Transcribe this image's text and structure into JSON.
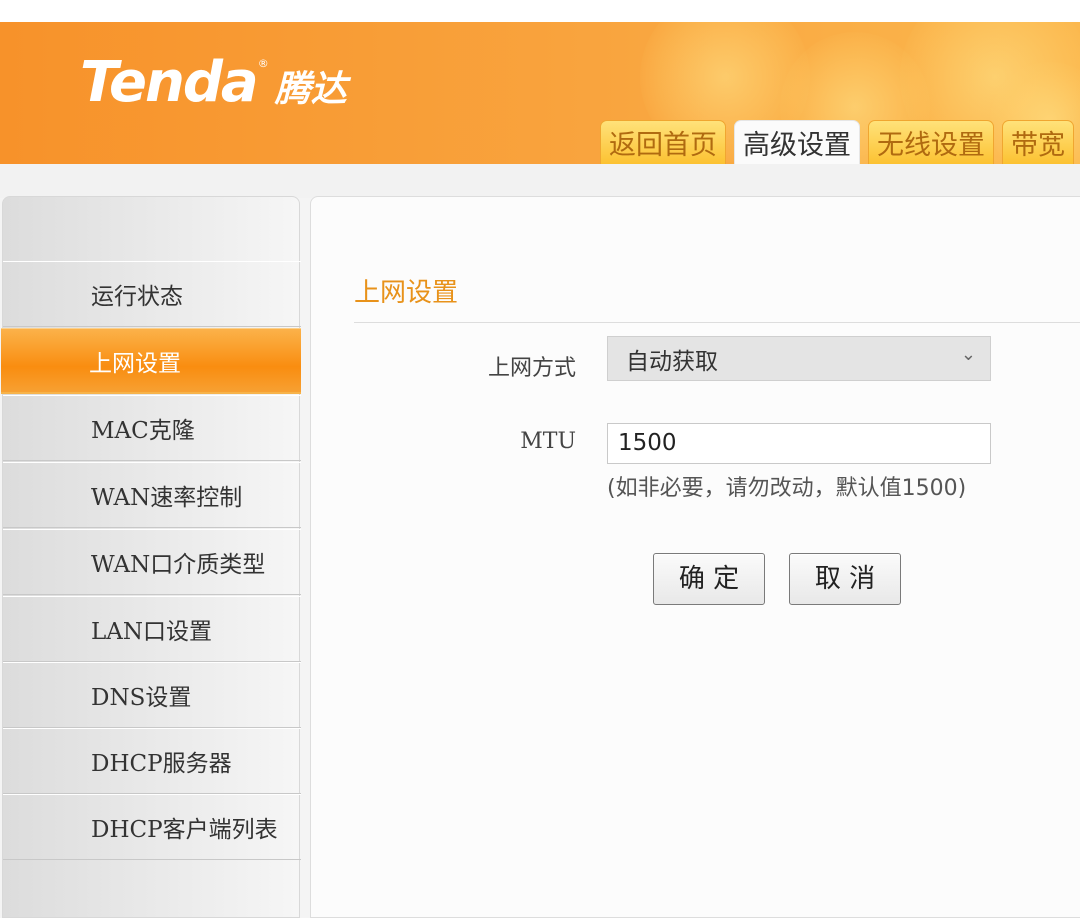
{
  "brand": {
    "name_en": "Tenda",
    "registered": "®",
    "name_cn": "腾达"
  },
  "tabs": [
    {
      "label": "返回首页",
      "active": false
    },
    {
      "label": "高级设置",
      "active": true
    },
    {
      "label": "无线设置",
      "active": false
    },
    {
      "label": "带宽",
      "active": false
    }
  ],
  "sidebar": {
    "items": [
      {
        "label": "运行状态",
        "active": false
      },
      {
        "label": "上网设置",
        "active": true
      },
      {
        "label": "MAC克隆",
        "active": false
      },
      {
        "label": "WAN速率控制",
        "active": false
      },
      {
        "label": "WAN口介质类型",
        "active": false
      },
      {
        "label": "LAN口设置",
        "active": false
      },
      {
        "label": "DNS设置",
        "active": false
      },
      {
        "label": "DHCP服务器",
        "active": false
      },
      {
        "label": "DHCP客户端列表",
        "active": false
      }
    ]
  },
  "main": {
    "title": "上网设置",
    "connection_type": {
      "label": "上网方式",
      "value": "自动获取"
    },
    "mtu": {
      "label": "MTU",
      "value": "1500",
      "hint": "(如非必要，请勿改动，默认值1500)"
    },
    "buttons": {
      "ok": "确 定",
      "cancel": "取 消"
    }
  },
  "colors": {
    "header_orange": "#f7922a",
    "tab_yellow": "#fcc232",
    "title_orange": "#e8921a",
    "active_sidebar": "#f98d10"
  }
}
